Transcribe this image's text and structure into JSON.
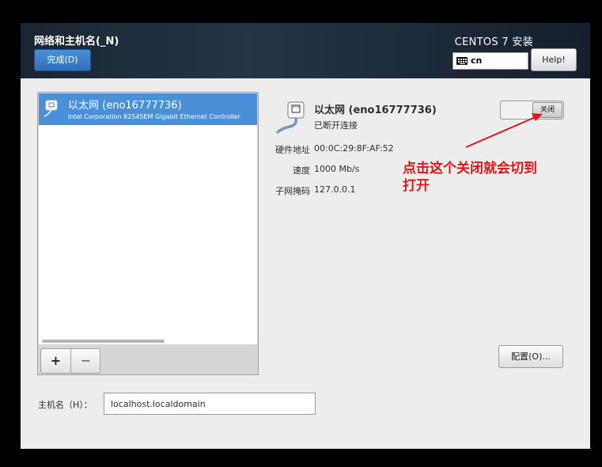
{
  "header": {
    "title": "网络和主机名(_N)",
    "done_label": "完成(D)",
    "product": "CENTOS 7 安装",
    "keyboard_layout": "cn",
    "help_label": "Help!"
  },
  "devices": [
    {
      "name": "以太网 (eno16777736)",
      "description": "Intel Corporation 82545EM Gigabit Ethernet Controller",
      "selected": true
    }
  ],
  "list_buttons": {
    "add": "+",
    "remove": "−"
  },
  "detail": {
    "name": "以太网 (eno16777736)",
    "status": "已断开连接",
    "toggle_label": "关闭",
    "properties": [
      {
        "label": "硬件地址",
        "value": "00:0C:29:8F:AF:52"
      },
      {
        "label": "速度",
        "value": "1000 Mb/s"
      },
      {
        "label": "子网掩码",
        "value": "127.0.0.1"
      }
    ],
    "configure_label": "配置(O)..."
  },
  "annotation": {
    "text_line1": "点击这个关闭就会切到",
    "text_line2": "打开",
    "color": "#e3161b"
  },
  "hostname": {
    "label": "主机名（H）：",
    "value": "localhost.localdomain"
  },
  "colors": {
    "header_bg": "#1f2d3d",
    "accent": "#4a90d9",
    "window_bg": "#ededed"
  }
}
